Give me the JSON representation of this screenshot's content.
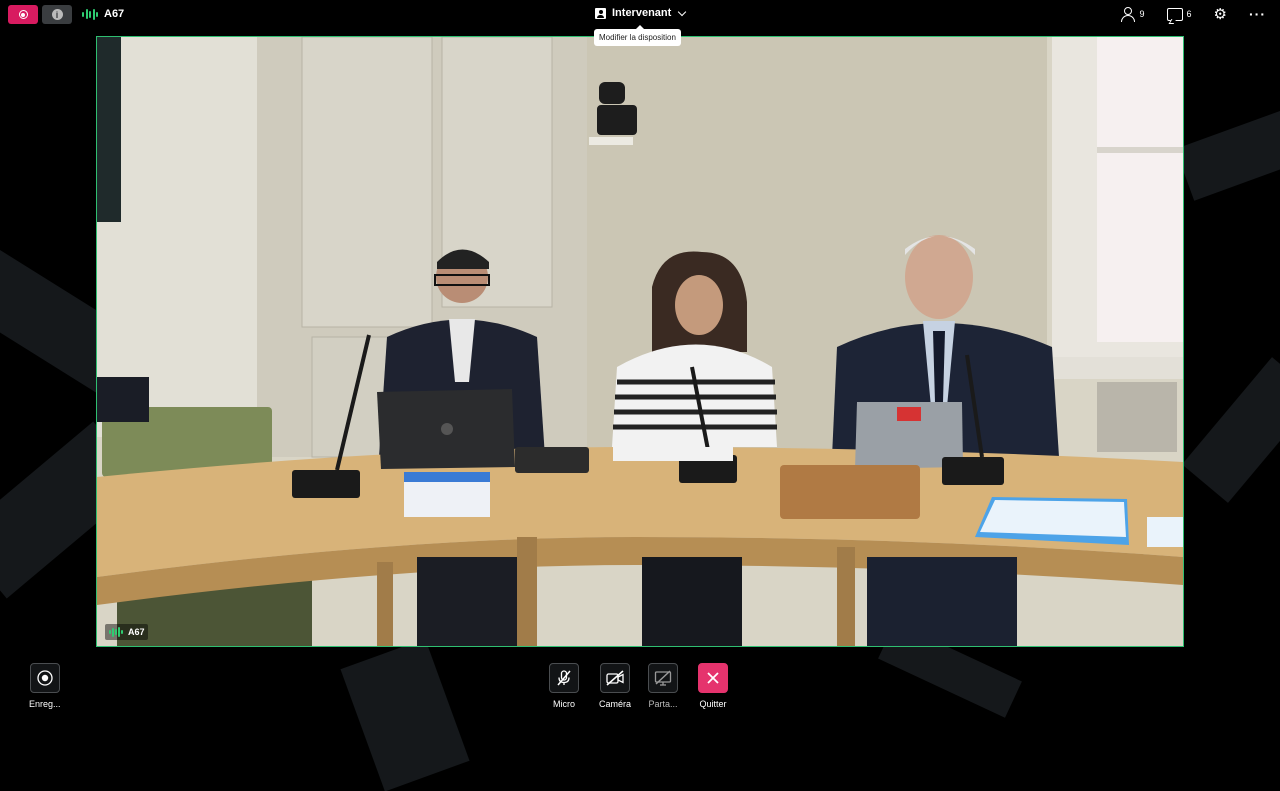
{
  "topbar": {
    "speaker_name": "A67",
    "layout_label": "Intervenant",
    "layout_tooltip": "Modifier la disposition",
    "participants_count": "9",
    "chat_count": "6"
  },
  "video": {
    "tile_label": "A67"
  },
  "controls": {
    "record_label": "Enreg...",
    "mic_label": "Micro",
    "camera_label": "Caméra",
    "share_label": "Parta...",
    "quit_label": "Quitter"
  },
  "colors": {
    "record_accent": "#d81b60",
    "quit_accent": "#e5336d",
    "speaking_green": "#2ecc71",
    "frame_border": "#2fbf71"
  },
  "icons": [
    "record-icon",
    "info-icon",
    "audio-level-icon",
    "layout-person-icon",
    "chevron-down-icon",
    "participants-icon",
    "chat-icon",
    "settings-icon",
    "more-options-icon",
    "mic-muted-icon",
    "camera-off-icon",
    "screen-share-off-icon",
    "close-icon"
  ]
}
